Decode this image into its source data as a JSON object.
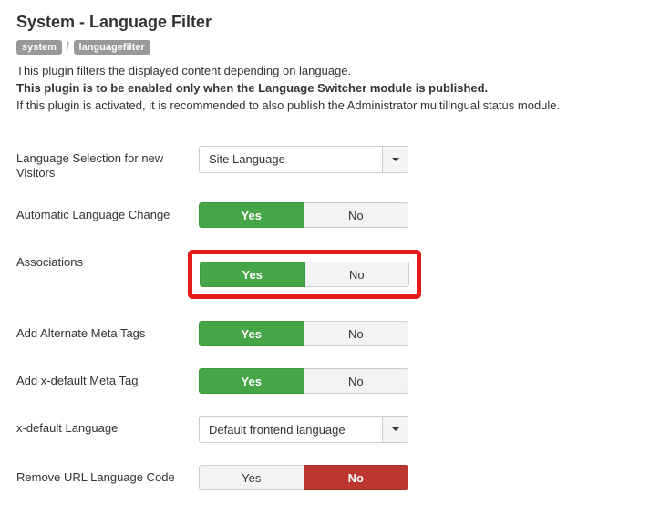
{
  "header": {
    "title": "System - Language Filter",
    "tags": {
      "system": "system",
      "filter": "languagefilter"
    }
  },
  "desc": {
    "line1": "This plugin filters the displayed content depending on language.",
    "line2": "This plugin is to be enabled only when the Language Switcher module is published.",
    "line3": "If this plugin is activated, it is recommended to also publish the Administrator multilingual status module."
  },
  "options": {
    "lang_selection": {
      "label": "Language Selection for new Visitors",
      "value": "Site Language"
    },
    "auto_change": {
      "label": "Automatic Language Change",
      "yes": "Yes",
      "no": "No",
      "value": "yes"
    },
    "associations": {
      "label": "Associations",
      "yes": "Yes",
      "no": "No",
      "value": "yes",
      "highlighted": true
    },
    "alt_meta": {
      "label": "Add Alternate Meta Tags",
      "yes": "Yes",
      "no": "No",
      "value": "yes"
    },
    "xdefault_meta": {
      "label": "Add x-default Meta Tag",
      "yes": "Yes",
      "no": "No",
      "value": "yes"
    },
    "xdefault_lang": {
      "label": "x-default Language",
      "value": "Default frontend language"
    },
    "remove_url": {
      "label": "Remove URL Language Code",
      "yes": "Yes",
      "no": "No",
      "value": "no"
    }
  }
}
